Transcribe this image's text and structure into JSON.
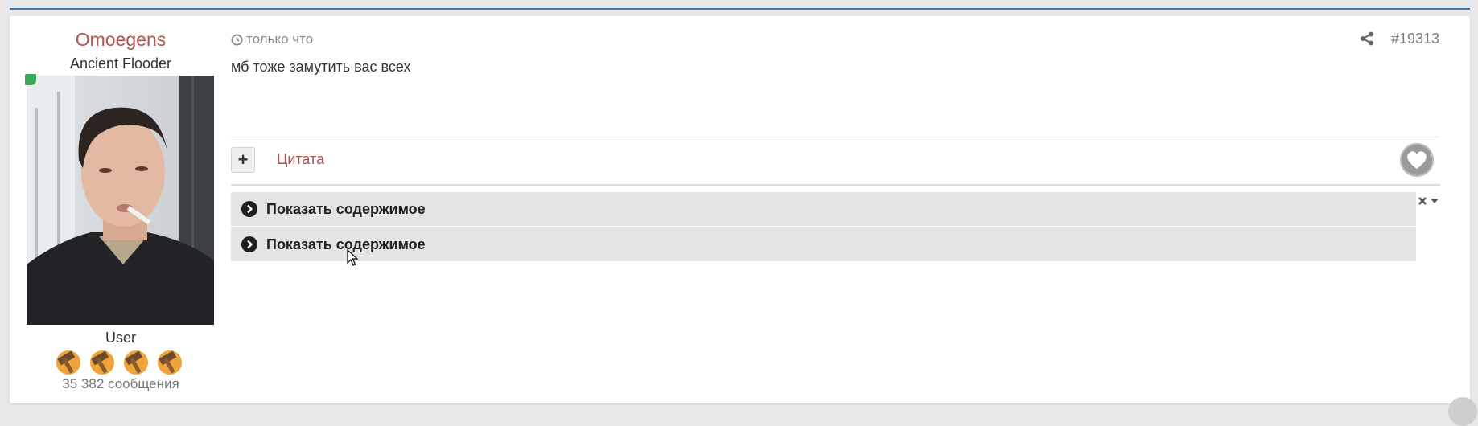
{
  "post": {
    "username": "Omoegens",
    "user_title": "Ancient Flooder",
    "user_role": "User",
    "post_count": "35 382 сообщения",
    "time": "только что",
    "post_number": "#19313",
    "message": "мб тоже замутить вас всех",
    "quote_label": "Цитата",
    "plus_label": "+"
  },
  "spoilers": [
    {
      "label": "Показать содержимое"
    },
    {
      "label": "Показать содержимое"
    }
  ],
  "colors": {
    "username": "#b0524f",
    "online": "#3aa856",
    "accent_rule": "#3a78b8"
  },
  "icons": [
    "clock-icon",
    "share-icon",
    "heart-icon",
    "chevron-right-icon",
    "close-icon",
    "caret-down-icon"
  ]
}
